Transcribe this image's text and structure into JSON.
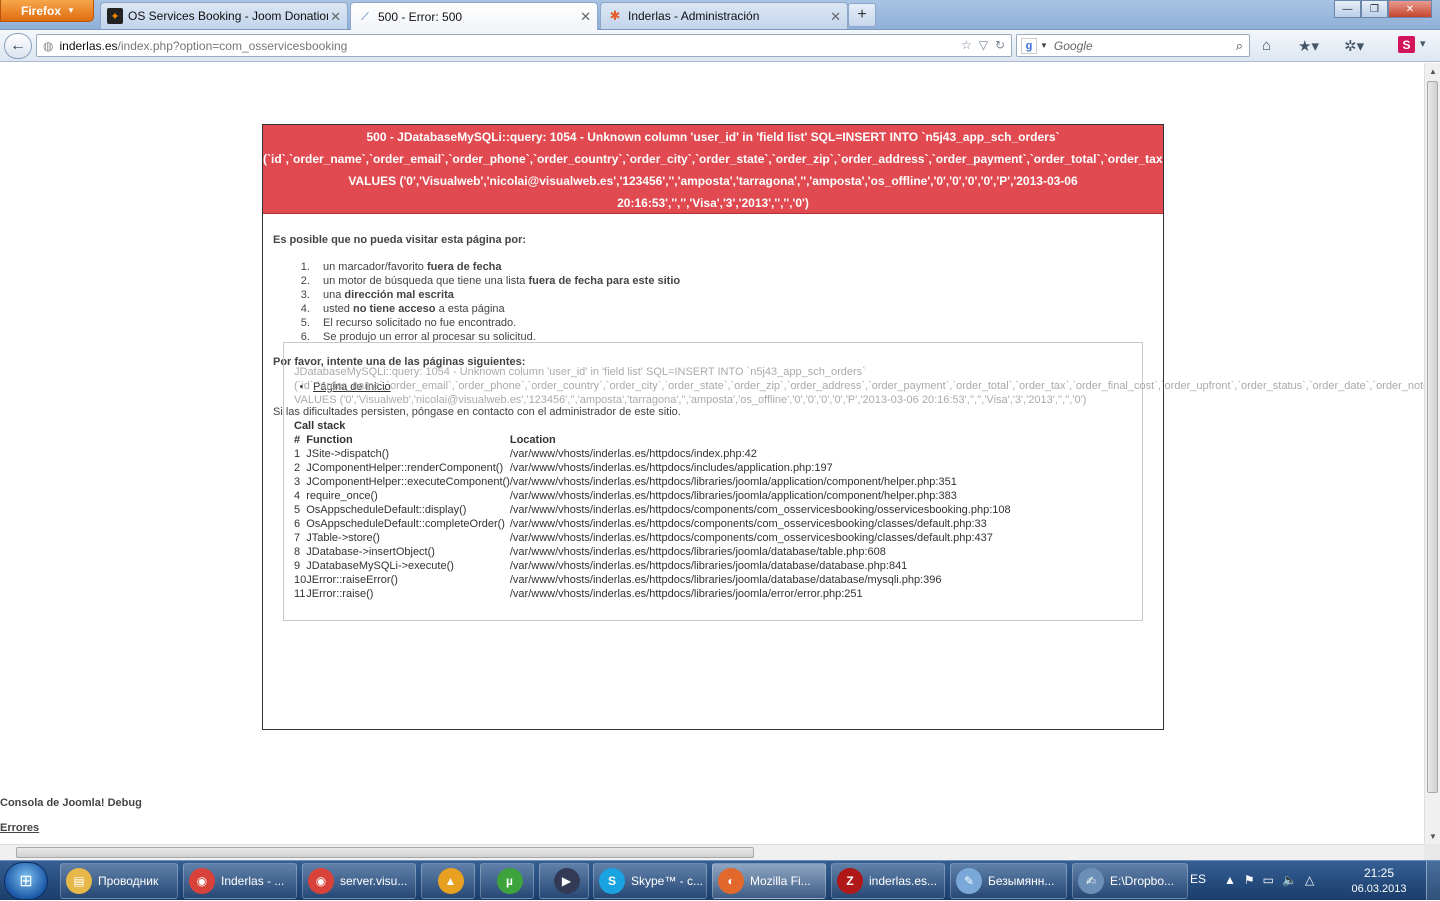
{
  "browser": {
    "menu_button": "Firefox",
    "tabs": [
      {
        "label": "OS Services Booking - Joom Donation",
        "icon": "joomdonation-icon"
      },
      {
        "label": "500 - Error: 500",
        "icon": "loading-icon"
      },
      {
        "label": "Inderlas - Administración",
        "icon": "joomla-icon"
      }
    ],
    "url_host": "inderlas.es",
    "url_path": "/index.php?option=com_osservicesbooking",
    "search_placeholder": "Google"
  },
  "error": {
    "header_lines": [
      "500 - JDatabaseMySQLi::query: 1054 - Unknown column 'user_id' in 'field list' SQL=INSERT INTO `n5j43_app_sch_orders`",
      "(`id`,`order_name`,`order_email`,`order_phone`,`order_country`,`order_city`,`order_state`,`order_zip`,`order_address`,`order_payment`,`order_total`,`order_tax`,`order_final_cost`,`order_upfront`,`order_status`,`order_date`,`order_notes`,`order_card_number`",
      "VALUES ('0','Visualweb','nicolai@visualweb.es','123456','','amposta','tarragona','','amposta','os_offline','0','0','0','0','P','2013-03-06",
      "20:16:53','','','Visa','3','2013','','','0')"
    ],
    "reasons_title": "Es posible que no pueda visitar esta página por:",
    "reasons": [
      {
        "pre": "un marcador/favorito ",
        "strong": "fuera de fecha",
        "post": ""
      },
      {
        "pre": "un motor de búsqueda que tiene una lista ",
        "strong": "fuera de fecha para este sitio",
        "post": ""
      },
      {
        "pre": "una ",
        "strong": "dirección mal escrita",
        "post": ""
      },
      {
        "pre": "usted ",
        "strong": "no tiene acceso",
        "post": " a esta página"
      },
      {
        "pre": "El recurso solicitado no fue encontrado.",
        "strong": "",
        "post": ""
      },
      {
        "pre": "Se produjo un error al procesar su solicitud.",
        "strong": "",
        "post": ""
      }
    ],
    "try_title": "Por favor, intente una de las páginas siguientes:",
    "home_link": "Página de inicio",
    "contact": "Si las dificultades persisten, póngase en contacto con el administrador de este sitio.",
    "detail_lines": [
      "JDatabaseMySQLi::query: 1054 - Unknown column 'user_id' in 'field list' SQL=INSERT INTO `n5j43_app_sch_orders`",
      "(`id`,`order_name`,`order_email`,`order_phone`,`order_country`,`order_city`,`order_state`,`order_zip`,`order_address`,`order_payment`,`order_total`,`order_tax`,`order_final_cost`,`order_upfront`,`order_status`,`order_date`,`order_notes`,`order_card_number`",
      "VALUES ('0','Visualweb','nicolai@visualweb.es','123456','','amposta','tarragona','','amposta','os_offline','0','0','0','0','P','2013-03-06 20:16:53','','','Visa','3','2013','','','0')"
    ],
    "callstack_title": "Call stack",
    "callstack_headers": [
      "#",
      "Function",
      "Location"
    ],
    "callstack": [
      {
        "n": "1",
        "fn": "JSite->dispatch()",
        "loc": "/var/www/vhosts/inderlas.es/httpdocs/index.php:42"
      },
      {
        "n": "2",
        "fn": "JComponentHelper::renderComponent()",
        "loc": "/var/www/vhosts/inderlas.es/httpdocs/includes/application.php:197"
      },
      {
        "n": "3",
        "fn": "JComponentHelper::executeComponent()",
        "loc": "/var/www/vhosts/inderlas.es/httpdocs/libraries/joomla/application/component/helper.php:351"
      },
      {
        "n": "4",
        "fn": "require_once()",
        "loc": "/var/www/vhosts/inderlas.es/httpdocs/libraries/joomla/application/component/helper.php:383"
      },
      {
        "n": "5",
        "fn": "OsAppscheduleDefault::display()",
        "loc": "/var/www/vhosts/inderlas.es/httpdocs/components/com_osservicesbooking/osservicesbooking.php:108"
      },
      {
        "n": "6",
        "fn": "OsAppscheduleDefault::completeOrder()",
        "loc": "/var/www/vhosts/inderlas.es/httpdocs/components/com_osservicesbooking/classes/default.php:33"
      },
      {
        "n": "7",
        "fn": "JTable->store()",
        "loc": "/var/www/vhosts/inderlas.es/httpdocs/components/com_osservicesbooking/classes/default.php:437"
      },
      {
        "n": "8",
        "fn": "JDatabase->insertObject()",
        "loc": "/var/www/vhosts/inderlas.es/httpdocs/libraries/joomla/database/table.php:608"
      },
      {
        "n": "9",
        "fn": "JDatabaseMySQLi->execute()",
        "loc": "/var/www/vhosts/inderlas.es/httpdocs/libraries/joomla/database/database.php:841"
      },
      {
        "n": "10",
        "fn": "JError::raiseError()",
        "loc": "/var/www/vhosts/inderlas.es/httpdocs/libraries/joomla/database/database/mysqli.php:396"
      },
      {
        "n": "11",
        "fn": "JError::raise()",
        "loc": "/var/www/vhosts/inderlas.es/httpdocs/libraries/joomla/error/error.php:251"
      }
    ]
  },
  "debug": {
    "title": "Consola de Joomla! Debug",
    "errors_link": "Errores"
  },
  "taskbar": {
    "items": [
      {
        "label": "Проводник",
        "icon": "explorer-icon",
        "color": "#e6b84a"
      },
      {
        "label": "Inderlas - ...",
        "icon": "chrome-icon",
        "color": "#d9423a"
      },
      {
        "label": "server.visu...",
        "icon": "chrome-icon",
        "color": "#d9423a"
      },
      {
        "label": "",
        "icon": "aimp-icon",
        "color": "#e8a020"
      },
      {
        "label": "",
        "icon": "utorrent-icon",
        "color": "#3da33d"
      },
      {
        "label": "",
        "icon": "video-editor-icon",
        "color": "#333a55"
      },
      {
        "label": "Skype™ - c...",
        "icon": "skype-icon",
        "color": "#19a3e0"
      },
      {
        "label": "Mozilla Fi...",
        "icon": "firefox-icon",
        "color": "#e2682b"
      },
      {
        "label": "inderlas.es...",
        "icon": "filezilla-icon",
        "color": "#b01818"
      },
      {
        "label": "Безымянн...",
        "icon": "paint-icon",
        "color": "#7aa8d8"
      },
      {
        "label": "E:\\Dropbo...",
        "icon": "notepad-icon",
        "color": "#6c8fb8"
      }
    ],
    "language": "ES",
    "time": "21:25",
    "date": "06.03.2013"
  },
  "colors": {
    "error_header": "#e04a50",
    "taskbar": "#1a3d6c"
  }
}
